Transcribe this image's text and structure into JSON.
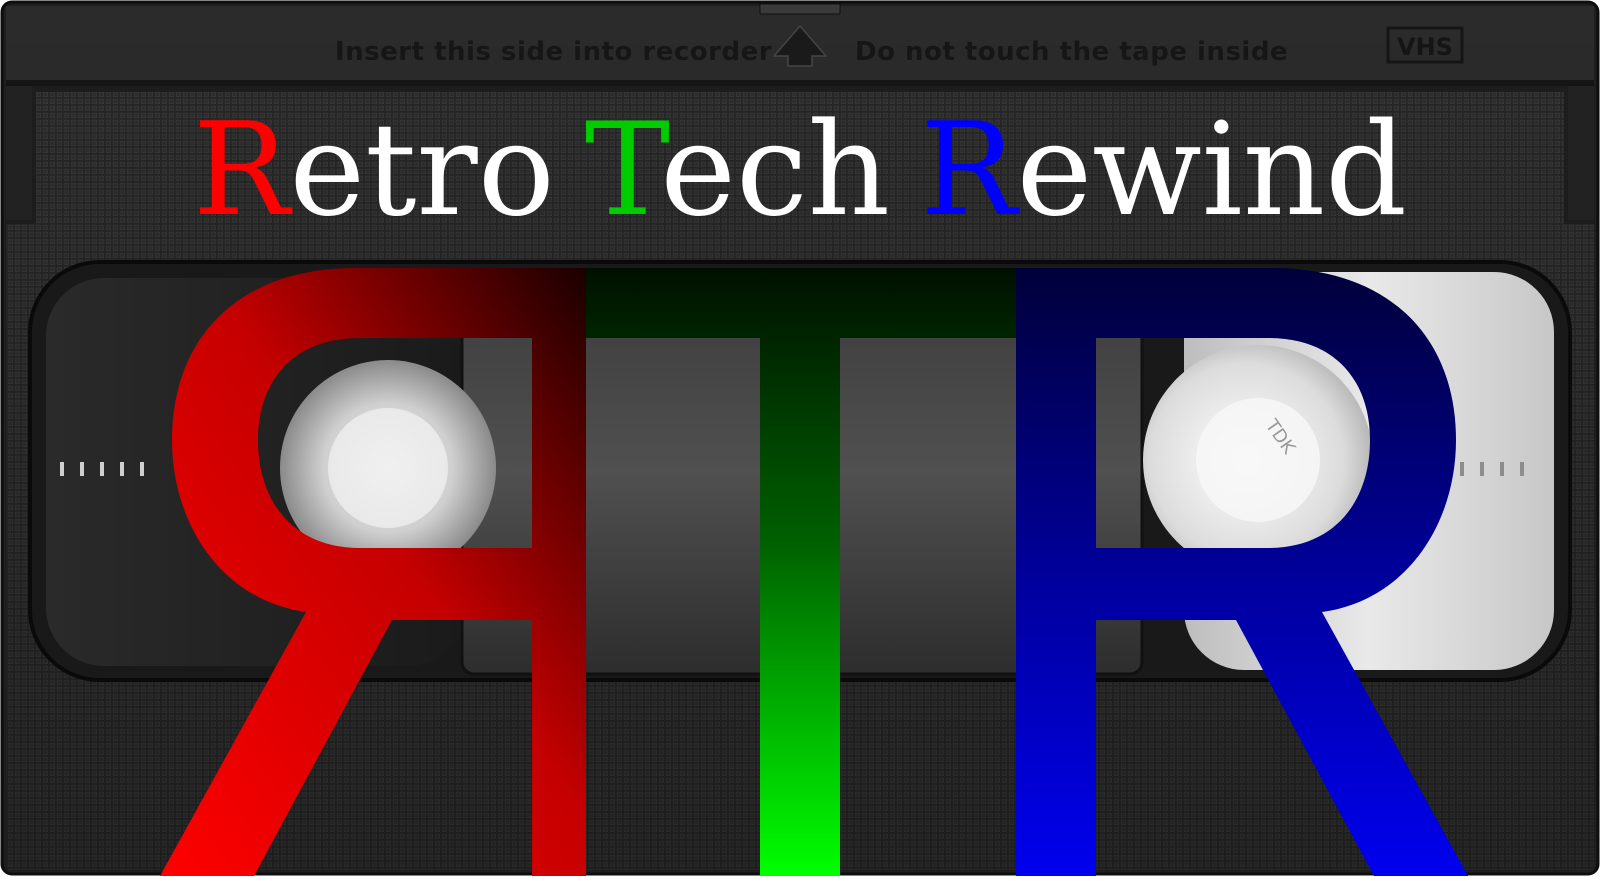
{
  "cassette": {
    "top_label_left": "Insert this side into recorder",
    "top_label_right": "Do not touch the tape inside",
    "format_badge": "VHS",
    "window_reel_marking": "TDK"
  },
  "title": {
    "words": [
      {
        "initial": "R",
        "rest": "etro",
        "initial_color": "#ff0000"
      },
      {
        "initial": "T",
        "rest": "ech",
        "initial_color": "#00cc00"
      },
      {
        "initial": "R",
        "rest": "ewind",
        "initial_color": "#0000ff"
      }
    ],
    "rest_color": "#ffffff"
  },
  "monogram": {
    "letters": [
      "Я",
      "T",
      "R"
    ],
    "colors": {
      "left_r": "#ff0000",
      "t": "#00ff00",
      "right_r": "#0000ff"
    }
  },
  "icons": {
    "arrow": "eject-arrow-icon"
  }
}
